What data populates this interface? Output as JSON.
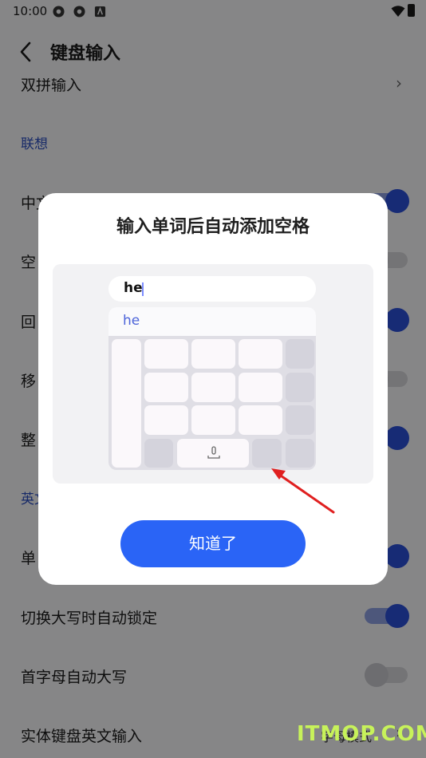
{
  "status_bar": {
    "time": "10:00"
  },
  "header": {
    "title": "键盘输入"
  },
  "settings": {
    "partial_top": "双拼输入",
    "section_lianxiang": "联想",
    "rows": [
      {
        "label": "中文"
      },
      {
        "label": "空"
      },
      {
        "label": "回"
      },
      {
        "label": "移"
      },
      {
        "label": "整"
      }
    ],
    "section_english": "英文",
    "english_rows": [
      {
        "label": "单"
      },
      {
        "label": "切换大写时自动锁定"
      },
      {
        "label": "首字母自动大写"
      },
      {
        "label": "实体键盘英文输入",
        "value": "字母模式"
      }
    ]
  },
  "dialog": {
    "title": "输入单词后自动添加空格",
    "typed_text": "he",
    "candidate": "he",
    "confirm_label": "知道了"
  },
  "watermark": "ITMOP.COM"
}
